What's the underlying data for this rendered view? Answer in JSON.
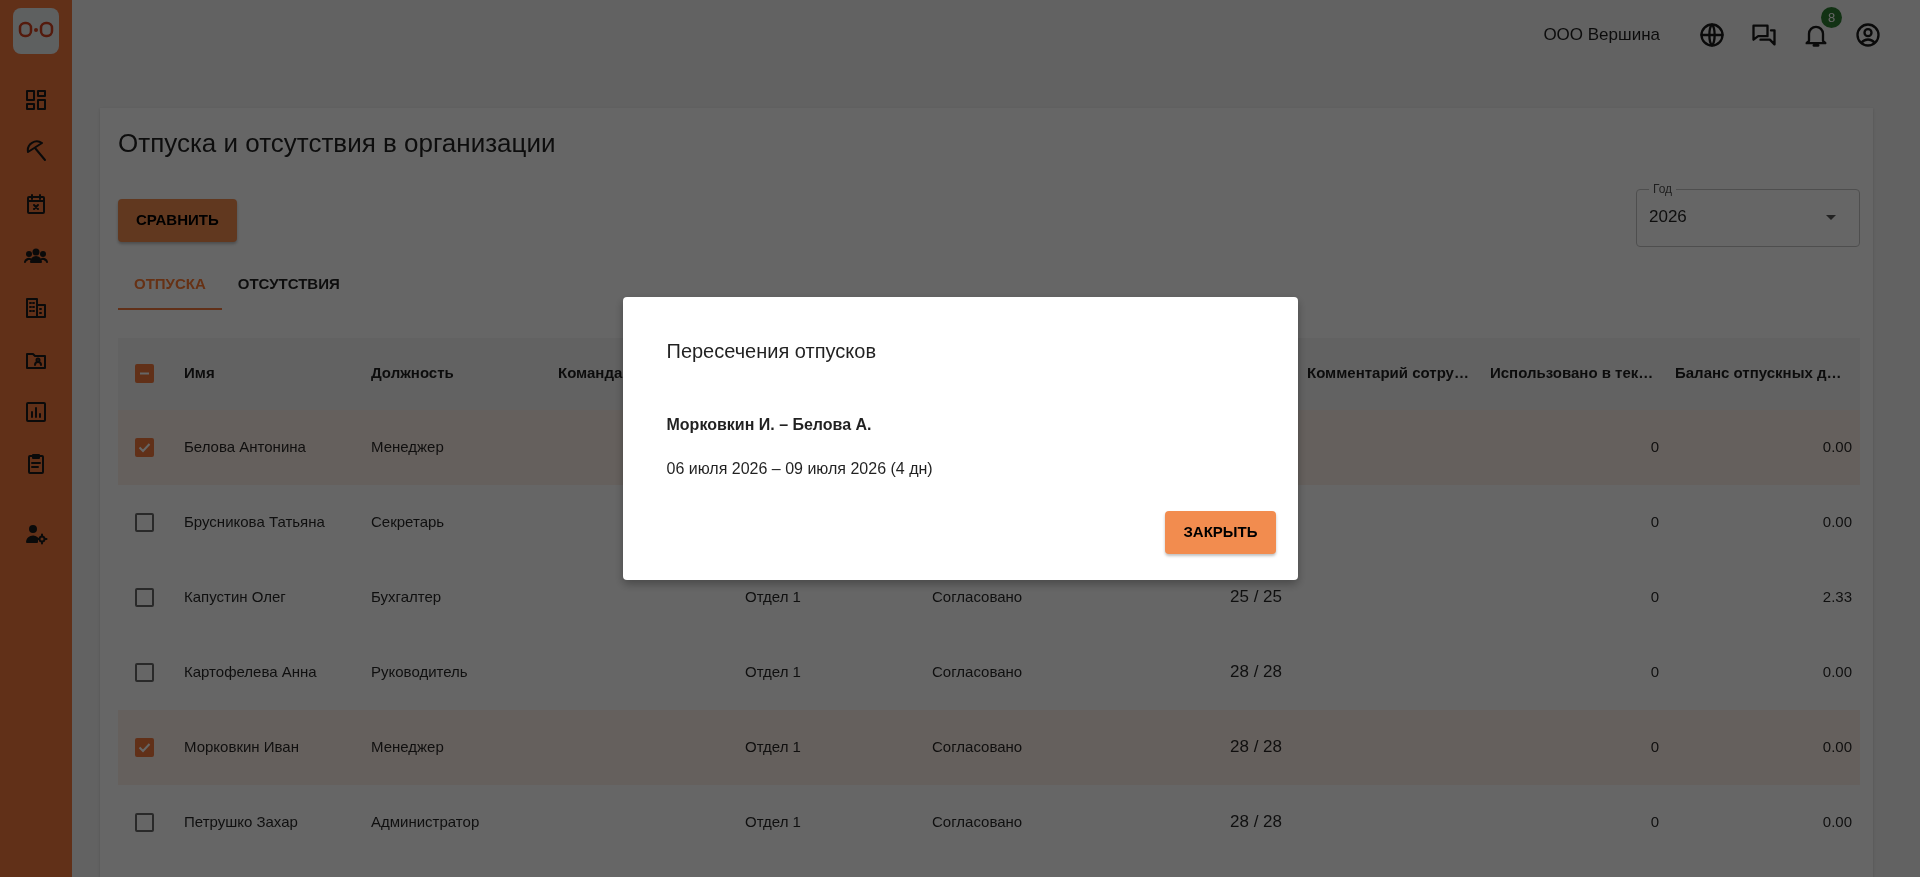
{
  "header": {
    "company": "ООО Вершина",
    "notifications_badge": "8"
  },
  "page": {
    "title": "Отпуска и отсутствия в организации",
    "compare_button": "СРАВНИТЬ",
    "year_select": {
      "label": "Год",
      "value": "2026"
    }
  },
  "tabs": [
    {
      "label": "ОТПУСКА",
      "selected": true
    },
    {
      "label": "ОТСУТСТВИЯ",
      "selected": false
    }
  ],
  "table": {
    "select_all": {
      "indeterminate": true
    },
    "columns": [
      "Имя",
      "Должность",
      "Команда",
      null,
      null,
      null,
      "Комментарий сотру…",
      "Использовано в тек…",
      "Баланс отпускных д…"
    ],
    "rows": [
      {
        "checked": true,
        "cells": [
          "Белова Антонина",
          "Менеджер",
          null,
          null,
          null,
          null,
          null,
          "0",
          "0.00"
        ]
      },
      {
        "checked": false,
        "cells": [
          "Брусникова Татьяна",
          "Секретарь",
          null,
          null,
          null,
          null,
          null,
          "0",
          "0.00"
        ]
      },
      {
        "checked": false,
        "cells": [
          "Капустин Олег",
          "Бухгалтер",
          null,
          "Отдел 1",
          "Согласовано",
          "25 / 25",
          null,
          "0",
          "2.33"
        ]
      },
      {
        "checked": false,
        "cells": [
          "Картофелева Анна",
          "Руководитель",
          null,
          "Отдел 1",
          "Согласовано",
          "28 / 28",
          null,
          "0",
          "0.00"
        ]
      },
      {
        "checked": true,
        "cells": [
          "Морковкин Иван",
          "Менеджер",
          null,
          "Отдел 1",
          "Согласовано",
          "28 / 28",
          null,
          "0",
          "0.00"
        ]
      },
      {
        "checked": false,
        "cells": [
          "Петрушко Захар",
          "Администратор",
          null,
          "Отдел 1",
          "Согласовано",
          "28 / 28",
          null,
          "0",
          "0.00"
        ]
      }
    ]
  },
  "modal": {
    "title": "Пересечения отпусков",
    "conflicts": [
      {
        "pair": "Морковкин И. – Белова А.",
        "period": "06 июля 2026 – 09 июля 2026 (4 дн)"
      }
    ],
    "close_button": "ЗАКРЫТЬ"
  }
}
